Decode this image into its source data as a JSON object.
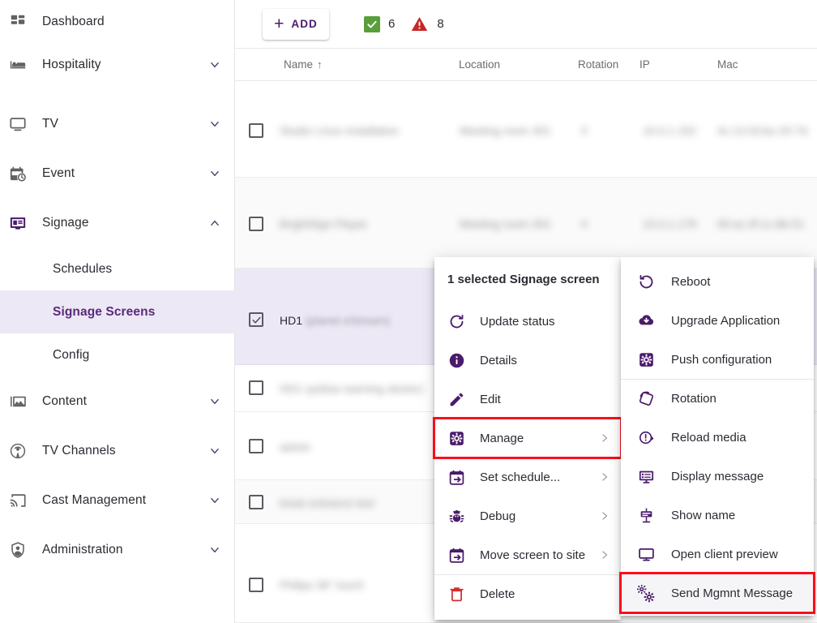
{
  "sidebar": {
    "items": [
      {
        "label": "Dashboard",
        "icon": "dashboard-icon",
        "expandable": false,
        "level": 0,
        "state": ""
      },
      {
        "label": "Hospitality",
        "icon": "bed-icon",
        "expandable": true,
        "level": 0,
        "state": "collapsed"
      },
      {
        "label": "TV",
        "icon": "tv-icon",
        "expandable": true,
        "level": 0,
        "state": "collapsed"
      },
      {
        "label": "Event",
        "icon": "event-icon",
        "expandable": true,
        "level": 0,
        "state": "collapsed"
      },
      {
        "label": "Signage",
        "icon": "signage-icon",
        "expandable": true,
        "level": 0,
        "state": "expanded"
      },
      {
        "label": "Schedules",
        "icon": "",
        "expandable": false,
        "level": 1,
        "state": ""
      },
      {
        "label": "Signage Screens",
        "icon": "",
        "expandable": false,
        "level": 1,
        "state": "active"
      },
      {
        "label": "Config",
        "icon": "",
        "expandable": false,
        "level": 1,
        "state": ""
      },
      {
        "label": "Content",
        "icon": "content-icon",
        "expandable": true,
        "level": 0,
        "state": "collapsed"
      },
      {
        "label": "TV Channels",
        "icon": "broadcast-icon",
        "expandable": true,
        "level": 0,
        "state": "collapsed"
      },
      {
        "label": "Cast Management",
        "icon": "cast-icon",
        "expandable": true,
        "level": 0,
        "state": "collapsed"
      },
      {
        "label": "Administration",
        "icon": "shield-user-icon",
        "expandable": true,
        "level": 0,
        "state": "collapsed"
      }
    ]
  },
  "toolbar": {
    "add_label": "ADD",
    "add_plus": "+",
    "ok_count": "6",
    "warn_count": "8"
  },
  "table": {
    "columns": [
      {
        "label": "Name",
        "sorted": true,
        "sort_arrow": "↑"
      },
      {
        "label": "Location",
        "sorted": false,
        "sort_arrow": ""
      },
      {
        "label": "Rotation",
        "sorted": false,
        "sort_arrow": ""
      },
      {
        "label": "IP",
        "sorted": false,
        "sort_arrow": ""
      },
      {
        "label": "Mac",
        "sorted": false,
        "sort_arrow": ""
      }
    ],
    "rows": [
      {
        "name": "Studio Linux installation",
        "location": "Meeting room 301",
        "rotation": "0",
        "ip": "10.0.1.152",
        "mac": "4c:13:33:bc:20:7d",
        "checked": false,
        "selected": false,
        "blurred": true
      },
      {
        "name": "BrightSign Player",
        "location": "Meeting room 301",
        "rotation": "0",
        "ip": "10.0.1.178",
        "mac": "90:ac:3f:1c:8b:51",
        "checked": false,
        "selected": false,
        "blurred": true
      },
      {
        "name": "HD1 (planet eStream)",
        "location": "",
        "rotation": "",
        "ip": "",
        "mac": "",
        "checked": true,
        "selected": true,
        "blurred": false
      },
      {
        "name": "HD1 (yellow warning sticker)",
        "location": "",
        "rotation": "",
        "ip": "",
        "mac": "",
        "checked": false,
        "selected": false,
        "blurred": true
      },
      {
        "name": "admin",
        "location": "",
        "rotation": "",
        "ip": "",
        "mac": "",
        "checked": false,
        "selected": false,
        "blurred": true
      },
      {
        "name": "kiosk entrance test",
        "location": "",
        "rotation": "",
        "ip": "",
        "mac": "",
        "checked": false,
        "selected": false,
        "blurred": true
      },
      {
        "name": "Philips 36\" touch",
        "location": "",
        "rotation": "",
        "ip": "",
        "mac": "",
        "checked": false,
        "selected": false,
        "blurred": true
      }
    ],
    "selected_row_name_prefix": "HD1 ",
    "selected_row_name_suffix": "(planet eStream)"
  },
  "context_menu": {
    "title": "1 selected Signage screen",
    "items": [
      {
        "label": "Update status",
        "icon": "refresh-icon",
        "has_submenu": false,
        "highlighted": false
      },
      {
        "label": "Details",
        "icon": "info-icon",
        "has_submenu": false,
        "highlighted": false
      },
      {
        "label": "Edit",
        "icon": "pencil-icon",
        "has_submenu": false,
        "highlighted": false
      },
      {
        "label": "Manage",
        "icon": "gear-box-icon",
        "has_submenu": true,
        "highlighted": true
      },
      {
        "label": "Set schedule...",
        "icon": "calendar-arrow-icon",
        "has_submenu": true,
        "highlighted": false
      },
      {
        "label": "Debug",
        "icon": "bug-icon",
        "has_submenu": true,
        "highlighted": false
      },
      {
        "label": "Move screen to site",
        "icon": "calendar-arrow-icon",
        "has_submenu": true,
        "highlighted": false
      },
      {
        "label": "Delete",
        "icon": "trash-icon",
        "has_submenu": false,
        "highlighted": false
      }
    ],
    "submenu_arrow": "›"
  },
  "submenu": {
    "items": [
      {
        "label": "Reboot",
        "icon": "reboot-icon",
        "highlighted": false,
        "separator_above": false
      },
      {
        "label": "Upgrade Application",
        "icon": "cloud-download-icon",
        "highlighted": false,
        "separator_above": false
      },
      {
        "label": "Push configuration",
        "icon": "gear-box-icon",
        "highlighted": false,
        "separator_above": false
      },
      {
        "label": "Rotation",
        "icon": "rotation-icon",
        "highlighted": false,
        "separator_above": true
      },
      {
        "label": "Reload media",
        "icon": "reload-alert-icon",
        "highlighted": false,
        "separator_above": false
      },
      {
        "label": "Display message",
        "icon": "display-message-icon",
        "highlighted": false,
        "separator_above": false
      },
      {
        "label": "Show name",
        "icon": "show-name-icon",
        "highlighted": false,
        "separator_above": false
      },
      {
        "label": "Open client preview",
        "icon": "monitor-icon",
        "highlighted": false,
        "separator_above": false
      },
      {
        "label": "Send Mgmnt Message",
        "icon": "gears-icon",
        "highlighted": true,
        "separator_above": true
      }
    ]
  },
  "colors": {
    "accent_purple": "#4a1b6b",
    "active_nav_bg": "#ece8f5",
    "active_nav_text": "#5b2a7a",
    "ok_green": "#5a9e3c",
    "warn_red": "#c62828",
    "delete_red": "#d32f2f",
    "highlight_red": "#fc0d1b",
    "row_selected_bg": "#ece8f5"
  }
}
